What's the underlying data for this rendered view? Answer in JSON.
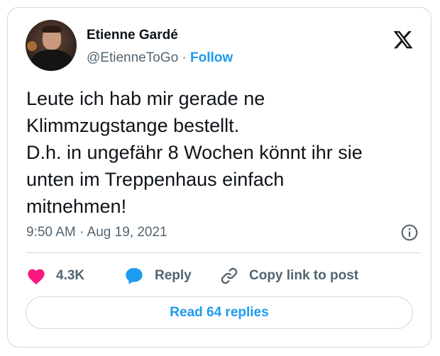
{
  "author": {
    "name": "Etienne Gardé",
    "handle": "@EtienneToGo",
    "separator": "·",
    "follow_label": "Follow"
  },
  "tweet": {
    "lines": [
      "Leute ich hab mir gerade ne",
      "Klimmzugstange bestellt.",
      "D.h. in ungefähr 8 Wochen könnt ihr sie",
      "unten im Treppenhaus einfach",
      "mitnehmen!"
    ],
    "timestamp": "9:50 AM · Aug 19, 2021"
  },
  "actions": {
    "like_count": "4.3K",
    "reply_label": "Reply",
    "copy_link_label": "Copy link to post"
  },
  "footer": {
    "read_replies_label": "Read 64 replies"
  },
  "colors": {
    "accent": "#1d9bf0",
    "like": "#f91880",
    "secondary_text": "#536471",
    "border": "#cfd9de"
  },
  "icons": {
    "brand": "x-logo-icon",
    "info": "info-icon",
    "like": "heart-icon",
    "reply": "speech-bubble-icon",
    "copy": "link-icon"
  }
}
